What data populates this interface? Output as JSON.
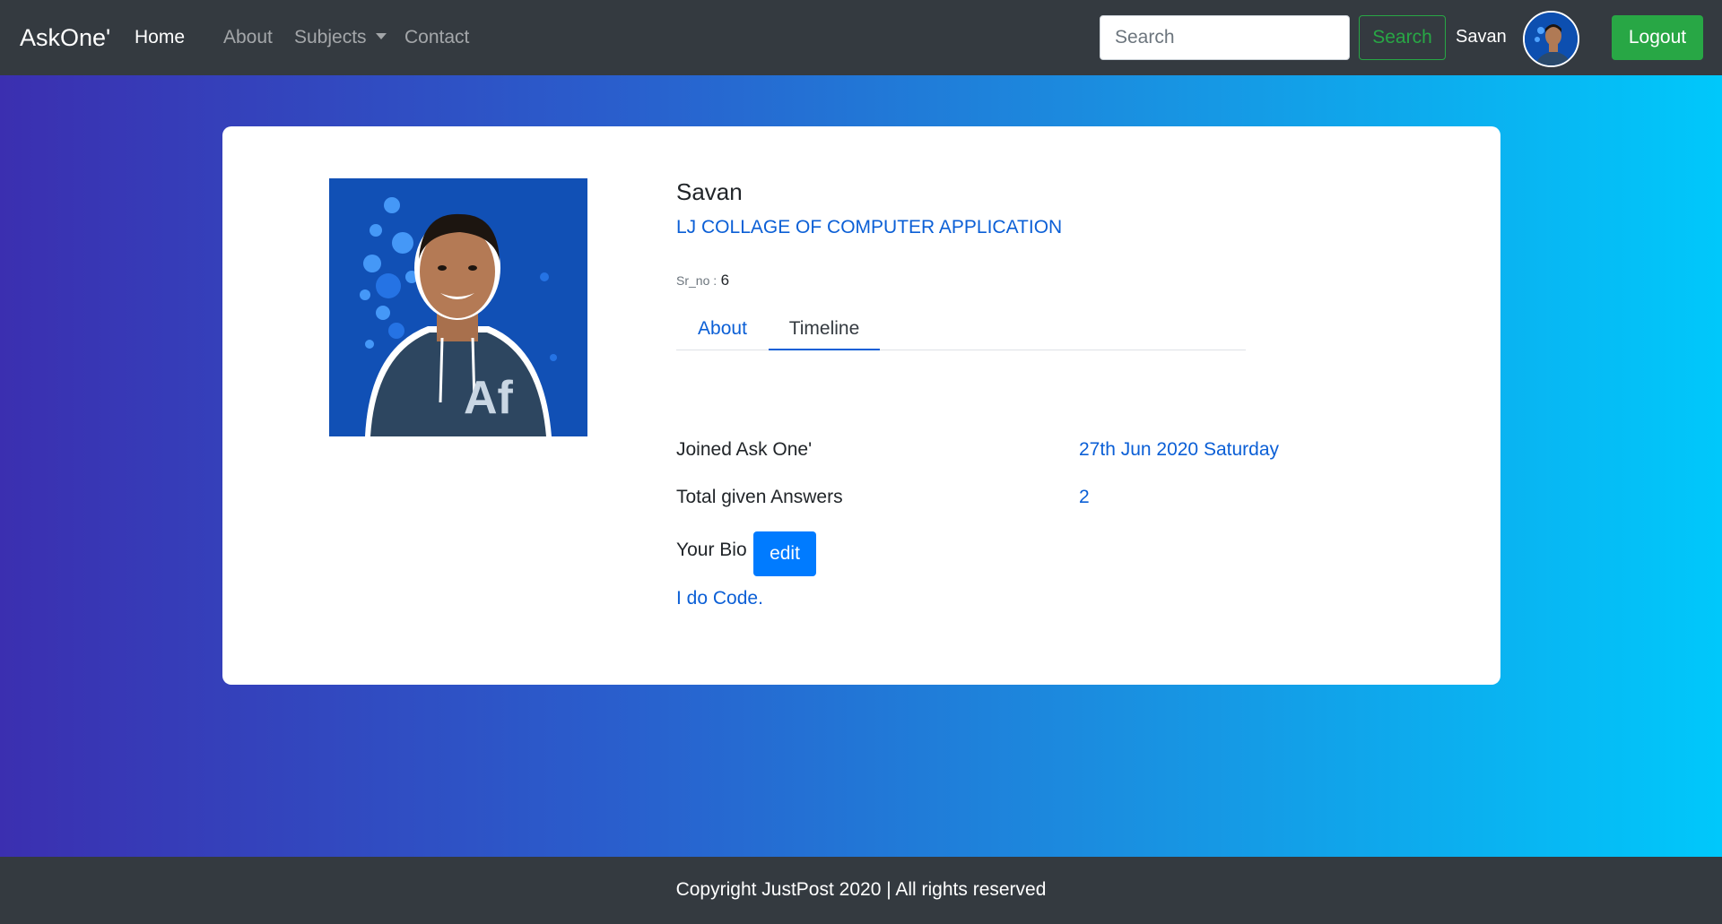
{
  "navbar": {
    "brand": "AskOne'",
    "links": {
      "home": "Home",
      "about": "About",
      "subjects": "Subjects",
      "contact": "Contact"
    },
    "search": {
      "placeholder": "Search",
      "button": "Search"
    },
    "user_name": "Savan",
    "logout": "Logout"
  },
  "profile": {
    "name": "Savan",
    "college": "LJ COLLAGE OF COMPUTER APPLICATION",
    "srno_label": "Sr_no :",
    "srno_value": "6",
    "tabs": [
      "About",
      "Timeline"
    ],
    "active_tab": "Timeline",
    "joined_label": "Joined Ask One'",
    "joined_value": "27th Jun 2020 Saturday",
    "answers_label": "Total given Answers",
    "answers_value": "2",
    "bio_label": "Your Bio",
    "edit_button": "edit",
    "bio_text": "I do Code."
  },
  "footer": {
    "text": "Copyright JustPost 2020 | All rights reserved"
  },
  "colors": {
    "navbar_bg": "#343a40",
    "link_blue": "#0b5fd6",
    "success": "#28a745",
    "primary": "#007bff",
    "gradient_start": "#3b2fb0",
    "gradient_end": "#00c8fb"
  }
}
